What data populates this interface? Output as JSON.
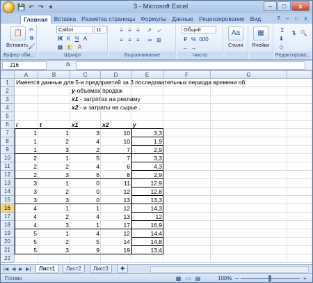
{
  "window": {
    "title": "3 - Microsoft Excel",
    "min": "–",
    "max": "□",
    "close": "x"
  },
  "qat": [
    "💾",
    "↶",
    "↷",
    "▾"
  ],
  "tabs": [
    "Главная",
    "Вставка",
    "Разметка страницы",
    "Формулы",
    "Данные",
    "Рецензирование",
    "Вид"
  ],
  "ribbon": {
    "paste_label": "Вставить",
    "clipboard_group": "Буфер обм...",
    "font_name": "Calibri",
    "font_size": "11",
    "font_group": "Шрифт",
    "bold": "Ж",
    "italic": "К",
    "underline": "Ч",
    "align_group": "Выравнивание",
    "number_format": "Общий",
    "number_group": "Число",
    "percent": "%",
    "thousands": "000",
    "styles_label": "Стили",
    "styles_group": "",
    "cells_label": "Ячейки",
    "cells_group": "",
    "editing_group": "Редактирова...",
    "sigma": "Σ"
  },
  "formula_bar": {
    "cell_ref": "J16",
    "fx": "fx",
    "content": ""
  },
  "columns": [
    "A",
    "B",
    "C",
    "D",
    "E",
    "F",
    "G"
  ],
  "rows": [
    "1",
    "2",
    "3",
    "4",
    "5",
    "6",
    "7",
    "8",
    "9",
    "10",
    "11",
    "12",
    "13",
    "14",
    "15",
    "16",
    "17",
    "18",
    "19",
    "20",
    "21",
    "22"
  ],
  "selected_row": "16",
  "notes": {
    "r2": "Имеется данные для 5-и предприятий за 3  последовательных периода времени об:",
    "r3_var": "у",
    "r3_text": "-объемах продаж",
    "r4_var": "х1",
    "r4_text": " - затрптах на рекламу",
    "r5_var": "х2",
    "r5_text": " - и затраты на сырье ."
  },
  "table_headers": [
    "i",
    "t",
    "x1",
    "x2",
    "y"
  ],
  "table_rows": [
    [
      "1",
      "1",
      "3",
      "10",
      "3,3"
    ],
    [
      "1",
      "2",
      "4",
      "10",
      "1,9"
    ],
    [
      "1",
      "3",
      "2",
      "7",
      "2,9"
    ],
    [
      "2",
      "1",
      "5",
      "7",
      "3,3"
    ],
    [
      "2",
      "2",
      "4",
      "6",
      "4,3"
    ],
    [
      "2",
      "3",
      "6",
      "8",
      "2,9"
    ],
    [
      "3",
      "1",
      "0",
      "11",
      "12,9"
    ],
    [
      "3",
      "2",
      "0",
      "12",
      "12,8"
    ],
    [
      "3",
      "3",
      "0",
      "13",
      "13,3"
    ],
    [
      "4",
      "1",
      "1",
      "12",
      "14,3"
    ],
    [
      "4",
      "2",
      "4",
      "13",
      "12"
    ],
    [
      "4",
      "3",
      "1",
      "17",
      "16,9"
    ],
    [
      "5",
      "1",
      "4",
      "12",
      "14,4"
    ],
    [
      "5",
      "2",
      "5",
      "14",
      "14,8"
    ],
    [
      "5",
      "3",
      "9",
      "19",
      "13,4"
    ]
  ],
  "sheets": [
    "Лист1",
    "Лист2",
    "Лист3"
  ],
  "status": {
    "text": "Готово",
    "zoom": "100%"
  }
}
